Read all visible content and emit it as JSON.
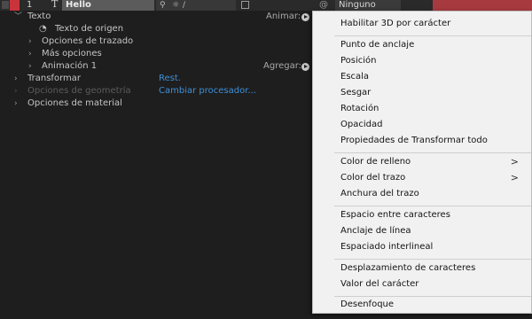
{
  "layer": {
    "number": "1",
    "type_icon": "T",
    "name": "Hello",
    "parent_value": "Ninguno",
    "label_color": "#c8343a"
  },
  "tree": {
    "texto": "Texto",
    "texto_origen": "Texto de origen",
    "opciones_trazado": "Opciones de trazado",
    "mas_opciones": "Más opciones",
    "animacion": "Animación 1",
    "transformar": "Transformar",
    "opciones_geometria": "Opciones de geometría",
    "opciones_material": "Opciones de material",
    "animar_label": "Animar:",
    "agregar_label": "Agregar:",
    "rest_link": "Rest.",
    "cambiar_link": "Cambiar procesador..."
  },
  "menu": {
    "items": [
      {
        "label": "Habilitar 3D por carácter"
      },
      {
        "label": "Punto de anclaje"
      },
      {
        "label": "Posición"
      },
      {
        "label": "Escala"
      },
      {
        "label": "Sesgar"
      },
      {
        "label": "Rotación"
      },
      {
        "label": "Opacidad"
      },
      {
        "label": "Propiedades de Transformar todo"
      },
      {
        "label": "Color de relleno",
        "submenu": ">"
      },
      {
        "label": "Color del trazo",
        "submenu": ">"
      },
      {
        "label": "Anchura del trazo"
      },
      {
        "label": "Espacio entre caracteres"
      },
      {
        "label": "Anclaje de línea"
      },
      {
        "label": "Espaciado interlineal"
      },
      {
        "label": "Desplazamiento de caracteres"
      },
      {
        "label": "Valor del carácter"
      },
      {
        "label": "Desenfoque"
      }
    ]
  },
  "colors": {
    "link": "#3f8fd8",
    "timeline_bar": "#a63a3f",
    "menu_bg": "#f1f1f1"
  }
}
